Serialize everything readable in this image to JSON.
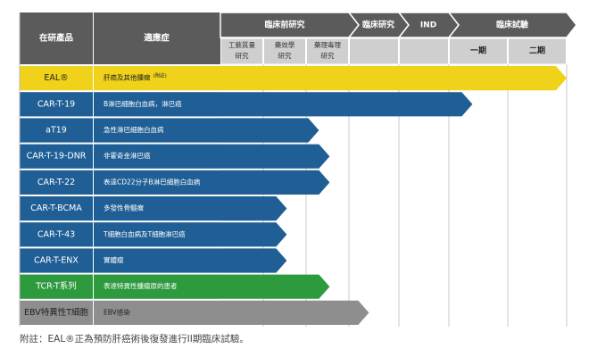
{
  "chart_data": {
    "type": "table",
    "header": {
      "product": "在研產品",
      "indication": "適應症",
      "phases": [
        "臨床前研究",
        "臨床研究",
        "IND",
        "臨床試驗"
      ],
      "subphases": [
        "工藝質量\n研究",
        "藥效學\n研究",
        "藥理毒理\n研究",
        "",
        "",
        "一期",
        "二期"
      ]
    },
    "rows": [
      {
        "product": "EAL®",
        "indication": "肝癌及其他腫瘤",
        "indication_note": "(附註)",
        "stage_end": 9.3,
        "color": "#f0d21b",
        "text_color": "#222222"
      },
      {
        "product": "CAR-T-19",
        "indication": "B淋巴細胞白血病，淋巴癌",
        "stage_end": 5.4,
        "color": "#1f5f96",
        "text_color": "#ffffff"
      },
      {
        "product": "aT19",
        "indication": "急性淋巴細胞白血病",
        "stage_end": 2.3,
        "color": "#1f5f96",
        "text_color": "#ffffff"
      },
      {
        "product": "CAR-T-19-DNR",
        "indication": "非霍奇金淋巴癌",
        "stage_end": 2.55,
        "color": "#1f5f96",
        "text_color": "#ffffff"
      },
      {
        "product": "CAR-T-22",
        "indication": "表達CD22分子B淋巴細胞白血病",
        "stage_end": 2.55,
        "color": "#1f5f96",
        "text_color": "#ffffff"
      },
      {
        "product": "CAR-T-BCMA",
        "indication": "多發性骨髓瘤",
        "stage_end": 1.55,
        "color": "#1f5f96",
        "text_color": "#ffffff"
      },
      {
        "product": "CAR-T-43",
        "indication": "T細胞白血病及T細胞淋巴癌",
        "stage_end": 1.55,
        "color": "#1f5f96",
        "text_color": "#ffffff"
      },
      {
        "product": "CAR-T-ENX",
        "indication": "實體瘤",
        "stage_end": 1.55,
        "color": "#1f5f96",
        "text_color": "#ffffff"
      },
      {
        "product": "TCR-T系列",
        "indication": "表達特異性腫瘤原的患者",
        "stage_end": 2.55,
        "color": "#2e9a3e",
        "text_color": "#ffffff"
      },
      {
        "product": "EBV特異性T細胞",
        "indication": "EBV感染",
        "stage_end": 3.4,
        "color": "#8e8e8e",
        "text_color": "#222222"
      }
    ],
    "footnote": "附註：EAL®正為預防肝癌術後復發進行II期臨床試驗。"
  }
}
